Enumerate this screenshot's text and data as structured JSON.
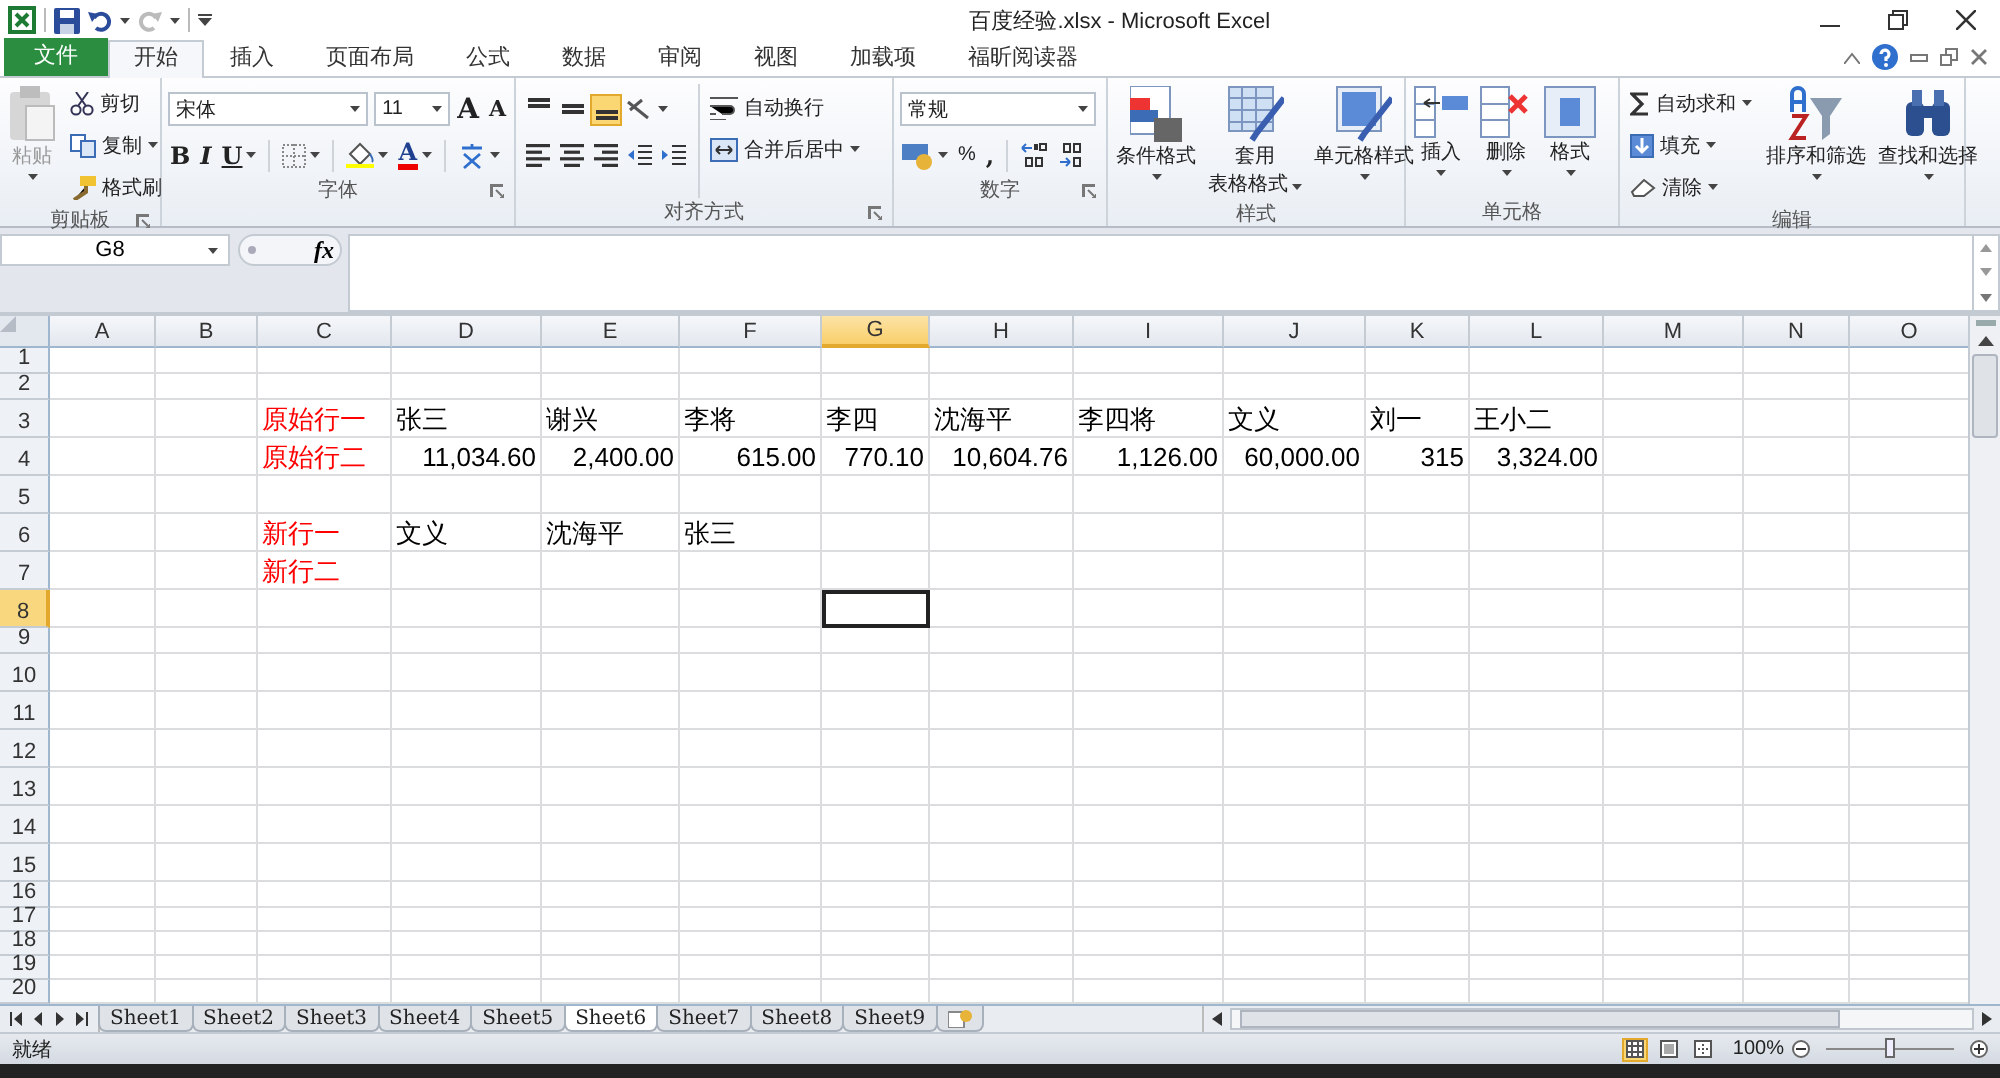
{
  "window": {
    "title": "百度经验.xlsx - Microsoft Excel"
  },
  "ribbon_tabs": [
    {
      "label": "文件",
      "kind": "file",
      "selected": false
    },
    {
      "label": "开始",
      "kind": "tab",
      "selected": true
    },
    {
      "label": "插入",
      "kind": "tab",
      "selected": false
    },
    {
      "label": "页面布局",
      "kind": "tab",
      "selected": false
    },
    {
      "label": "公式",
      "kind": "tab",
      "selected": false
    },
    {
      "label": "数据",
      "kind": "tab",
      "selected": false
    },
    {
      "label": "审阅",
      "kind": "tab",
      "selected": false
    },
    {
      "label": "视图",
      "kind": "tab",
      "selected": false
    },
    {
      "label": "加载项",
      "kind": "tab",
      "selected": false
    },
    {
      "label": "福昕阅读器",
      "kind": "tab",
      "selected": false
    }
  ],
  "clipboard": {
    "label": "剪贴板",
    "paste": {
      "label": "粘贴",
      "disabled": true
    },
    "items": [
      "剪切",
      "复制",
      "格式刷"
    ]
  },
  "font": {
    "label": "字体",
    "name": "宋体",
    "size": "11",
    "grow": "A",
    "shrink": "A",
    "bold": "B",
    "italic": "I",
    "underline": "U",
    "color_letter": "A"
  },
  "alignment": {
    "label": "对齐方式",
    "vertical": [
      {
        "selected": false
      },
      {
        "selected": false
      },
      {
        "selected": true
      }
    ],
    "wrap": "自动换行",
    "merge": "合并后居中"
  },
  "number": {
    "label": "数字",
    "format": "常规",
    "percent": "%",
    "comma": ","
  },
  "styles": {
    "label": "样式",
    "buttons": [
      {
        "lines": [
          "条件格式"
        ]
      },
      {
        "lines": [
          "套用",
          "表格格式"
        ]
      },
      {
        "lines": [
          "单元格样式"
        ]
      }
    ]
  },
  "cells_group": {
    "label": "单元格",
    "buttons": [
      {
        "lines": [
          "插入"
        ]
      },
      {
        "lines": [
          "删除"
        ]
      },
      {
        "lines": [
          "格式"
        ]
      }
    ]
  },
  "editing": {
    "label": "编辑",
    "small": [
      "自动求和",
      "填充",
      "清除"
    ],
    "buttons": [
      {
        "lines": [
          "排序和筛选"
        ]
      },
      {
        "lines": [
          "查找和选择"
        ]
      }
    ]
  },
  "formula_bar": {
    "name_box": "G8",
    "fx": "fx"
  },
  "columns": [
    {
      "letter": "A",
      "selected": false
    },
    {
      "letter": "B",
      "selected": false
    },
    {
      "letter": "C",
      "selected": false
    },
    {
      "letter": "D",
      "selected": false
    },
    {
      "letter": "E",
      "selected": false
    },
    {
      "letter": "F",
      "selected": false
    },
    {
      "letter": "G",
      "selected": true
    },
    {
      "letter": "H",
      "selected": false
    },
    {
      "letter": "I",
      "selected": false
    },
    {
      "letter": "J",
      "selected": false
    },
    {
      "letter": "K",
      "selected": false
    },
    {
      "letter": "L",
      "selected": false
    },
    {
      "letter": "M",
      "selected": false
    },
    {
      "letter": "N",
      "selected": false
    },
    {
      "letter": "O",
      "selected": false
    }
  ],
  "rows": [
    {
      "number": "1",
      "selected": false,
      "cells": []
    },
    {
      "number": "2",
      "selected": false,
      "cells": []
    },
    {
      "number": "3",
      "selected": false,
      "cells": [
        {
          "text": "原始行一",
          "kind": "text",
          "color": "#ff0000"
        },
        {
          "text": "张三",
          "kind": "text",
          "color": "#000000"
        },
        {
          "text": "谢兴",
          "kind": "text",
          "color": "#000000"
        },
        {
          "text": "李将",
          "kind": "text",
          "color": "#000000"
        },
        {
          "text": "李四",
          "kind": "text",
          "color": "#000000"
        },
        {
          "text": "沈海平",
          "kind": "text",
          "color": "#000000"
        },
        {
          "text": "李四将",
          "kind": "text",
          "color": "#000000"
        },
        {
          "text": "文义",
          "kind": "text",
          "color": "#000000"
        },
        {
          "text": "刘一",
          "kind": "text",
          "color": "#000000"
        },
        {
          "text": "王小二",
          "kind": "text",
          "color": "#000000"
        }
      ]
    },
    {
      "number": "4",
      "selected": false,
      "cells": [
        {
          "text": "原始行二",
          "kind": "text",
          "color": "#ff0000"
        },
        {
          "text": "11,034.60",
          "kind": "number",
          "color": "#000000"
        },
        {
          "text": "2,400.00",
          "kind": "number",
          "color": "#000000"
        },
        {
          "text": "615.00",
          "kind": "number",
          "color": "#000000"
        },
        {
          "text": "770.10",
          "kind": "number",
          "color": "#000000"
        },
        {
          "text": "10,604.76",
          "kind": "number",
          "color": "#000000"
        },
        {
          "text": "1,126.00",
          "kind": "number",
          "color": "#000000"
        },
        {
          "text": "60,000.00",
          "kind": "number",
          "color": "#000000"
        },
        {
          "text": "315",
          "kind": "number",
          "color": "#000000"
        },
        {
          "text": "3,324.00",
          "kind": "number",
          "color": "#000000"
        }
      ]
    },
    {
      "number": "5",
      "selected": false,
      "cells": []
    },
    {
      "number": "6",
      "selected": false,
      "cells": [
        {
          "text": "新行一",
          "kind": "text",
          "color": "#ff0000"
        },
        {
          "text": "文义",
          "kind": "text",
          "color": "#000000"
        },
        {
          "text": "沈海平",
          "kind": "text",
          "color": "#000000"
        },
        {
          "text": "张三",
          "kind": "text",
          "color": "#000000"
        }
      ]
    },
    {
      "number": "7",
      "selected": false,
      "cells": [
        {
          "text": "新行二",
          "kind": "text",
          "color": "#ff0000"
        }
      ]
    },
    {
      "number": "8",
      "selected": true,
      "cells": []
    },
    {
      "number": "9",
      "selected": false,
      "cells": []
    },
    {
      "number": "10",
      "selected": false,
      "cells": []
    },
    {
      "number": "11",
      "selected": false,
      "cells": []
    },
    {
      "number": "12",
      "selected": false,
      "cells": []
    },
    {
      "number": "13",
      "selected": false,
      "cells": []
    },
    {
      "number": "14",
      "selected": false,
      "cells": []
    },
    {
      "number": "15",
      "selected": false,
      "cells": []
    },
    {
      "number": "16",
      "selected": false,
      "cells": []
    },
    {
      "number": "17",
      "selected": false,
      "cells": []
    },
    {
      "number": "18",
      "selected": false,
      "cells": []
    },
    {
      "number": "19",
      "selected": false,
      "cells": []
    },
    {
      "number": "20",
      "selected": false,
      "cells": []
    }
  ],
  "sheet_tabs": [
    {
      "label": "Sheet1",
      "selected": false
    },
    {
      "label": "Sheet2",
      "selected": false
    },
    {
      "label": "Sheet3",
      "selected": false
    },
    {
      "label": "Sheet4",
      "selected": false
    },
    {
      "label": "Sheet5",
      "selected": false
    },
    {
      "label": "Sheet6",
      "selected": true
    },
    {
      "label": "Sheet7",
      "selected": false
    },
    {
      "label": "Sheet8",
      "selected": false
    },
    {
      "label": "Sheet9",
      "selected": false
    }
  ],
  "status_bar": {
    "status": "就绪",
    "views": [
      {
        "selected": true
      },
      {
        "selected": false
      },
      {
        "selected": false
      }
    ],
    "zoom": "100%",
    "zoom_slider": {
      "level": 0.5
    }
  }
}
